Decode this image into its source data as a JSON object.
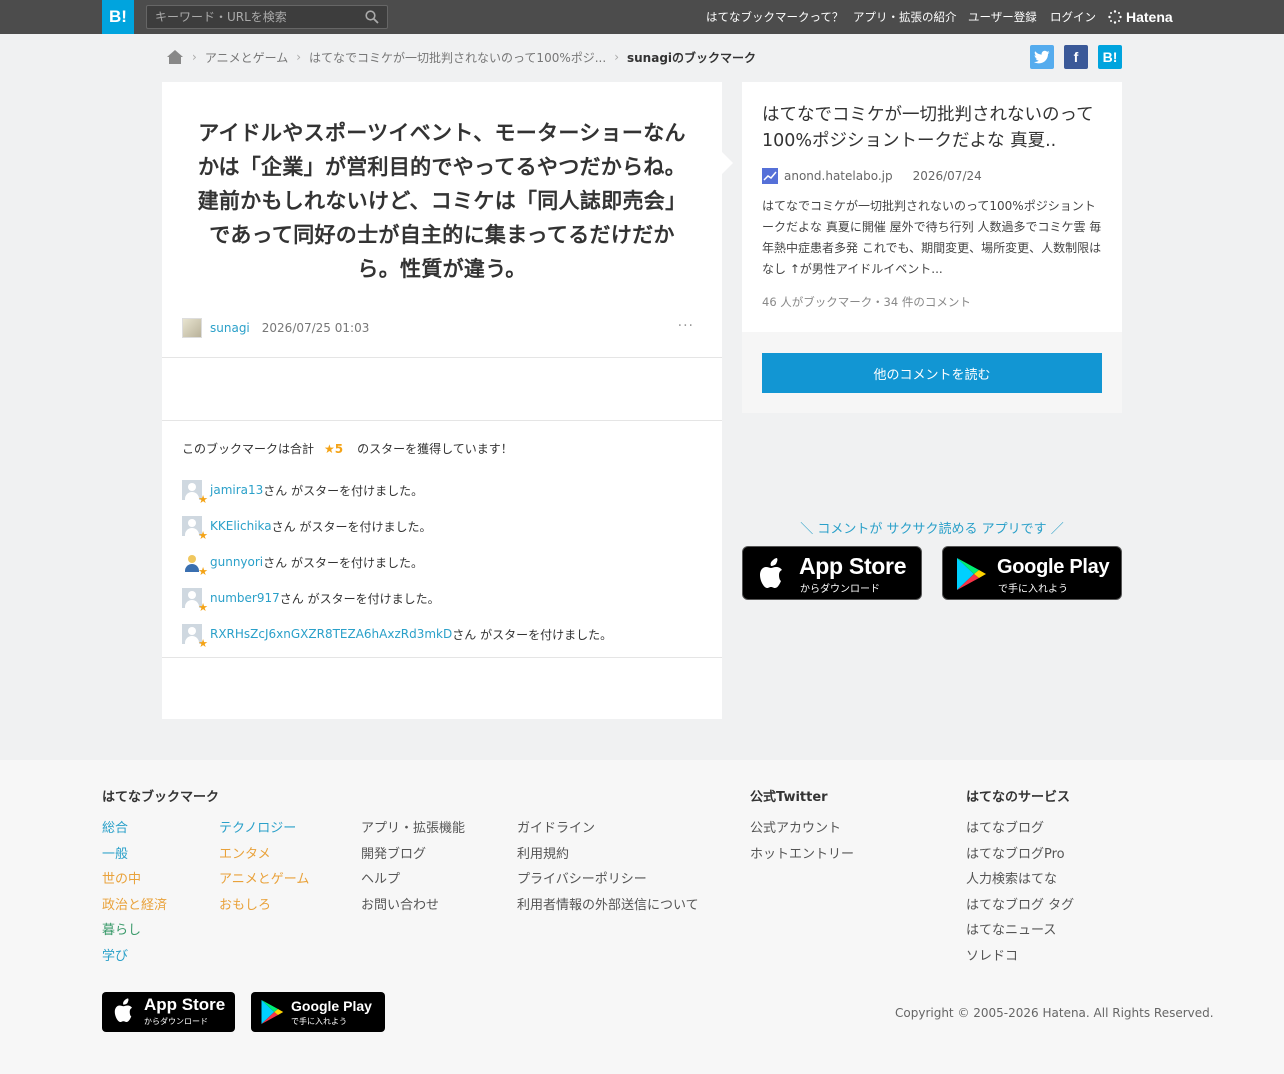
{
  "header": {
    "logo": "B!",
    "search_placeholder": "キーワード・URLを検索",
    "nav": [
      "はてなブックマークって？",
      "アプリ・拡張の紹介",
      "ユーザー登録",
      "ログイン"
    ],
    "brand": "Hatena"
  },
  "breadcrumb": {
    "items": [
      "アニメとゲーム",
      "はてなでコミケが一切批判されないのって100%ポジ...",
      "sunagiのブックマーク"
    ]
  },
  "share": {
    "twitter": "twitter-share",
    "facebook": "f",
    "hatena": "B!"
  },
  "bookmark": {
    "comment": "アイドルやスポーツイベント、モーターショーなんかは「企業」が営利目的でやってるやつだからね。建前かもしれないけど、コミケは「同人誌即売会」であって同好の士が自主的に集まってるだけだから。性質が違う。",
    "user": "sunagi",
    "datetime": "2026/07/25 01:03",
    "more": "···"
  },
  "stars": {
    "head_prefix": "このブックマークは合計",
    "count": "★5",
    "head_suffix": "のスターを獲得しています！",
    "suffix": "さん がスターを付けました。",
    "users": [
      "jamira13",
      "KKElichika",
      "gunnyori",
      "number917",
      "RXRHsZcJ6xnGXZR8TEZA6hAxzRd3mkD"
    ]
  },
  "entry": {
    "title": "はてなでコミケが一切批判されないのって100%ポジショントークだよな 真夏..",
    "source": "anond.hatelabo.jp",
    "date": "2026/07/24",
    "description": "はてなでコミケが一切批判されないのって100%ポジショントークだよな 真夏に開催 屋外で待ち行列 人数過多でコミケ雲 毎年熱中症患者多発 これでも、期間変更、場所変更、人数制限はなし ↑が男性アイドルイベント...",
    "count": "46 人がブックマーク・34 件のコメント",
    "button": "他のコメントを読む"
  },
  "app_promo": {
    "text": "＼ コメントが サクサク読める アプリです ／",
    "appstore_big": "App Store",
    "appstore_small": "からダウンロード",
    "googleplay_big": "Google Play",
    "googleplay_small": "で手に入れよう"
  },
  "footer": {
    "heading_bookmark": "はてなブックマーク",
    "col1": [
      "総合",
      "一般",
      "世の中",
      "政治と経済",
      "暮らし",
      "学び"
    ],
    "col2": [
      "テクノロジー",
      "エンタメ",
      "アニメとゲーム",
      "おもしろ"
    ],
    "col3": [
      "アプリ・拡張機能",
      "開発ブログ",
      "ヘルプ",
      "お問い合わせ"
    ],
    "col4": [
      "ガイドライン",
      "利用規約",
      "プライバシーポリシー",
      "利用者情報の外部送信について"
    ],
    "heading_twitter": "公式Twitter",
    "twitter": [
      "公式アカウント",
      "ホットエントリー"
    ],
    "heading_services": "はてなのサービス",
    "services": [
      "はてなブログ",
      "はてなブログPro",
      "人力検索はてな",
      "はてなブログ タグ",
      "はてなニュース",
      "ソレドコ"
    ],
    "copyright": "Copyright © 2005-2026 Hatena. All Rights Reserved.",
    "appstore_big": "App Store",
    "appstore_small": "からダウンロード",
    "googleplay_big": "Google Play",
    "googleplay_small": "で手に入れよう"
  },
  "colors": {
    "accent": "#00a4de",
    "button": "#1296d3",
    "link": "#2aa0c9",
    "star": "#f4a316",
    "topbar": "#4c4c4c"
  }
}
